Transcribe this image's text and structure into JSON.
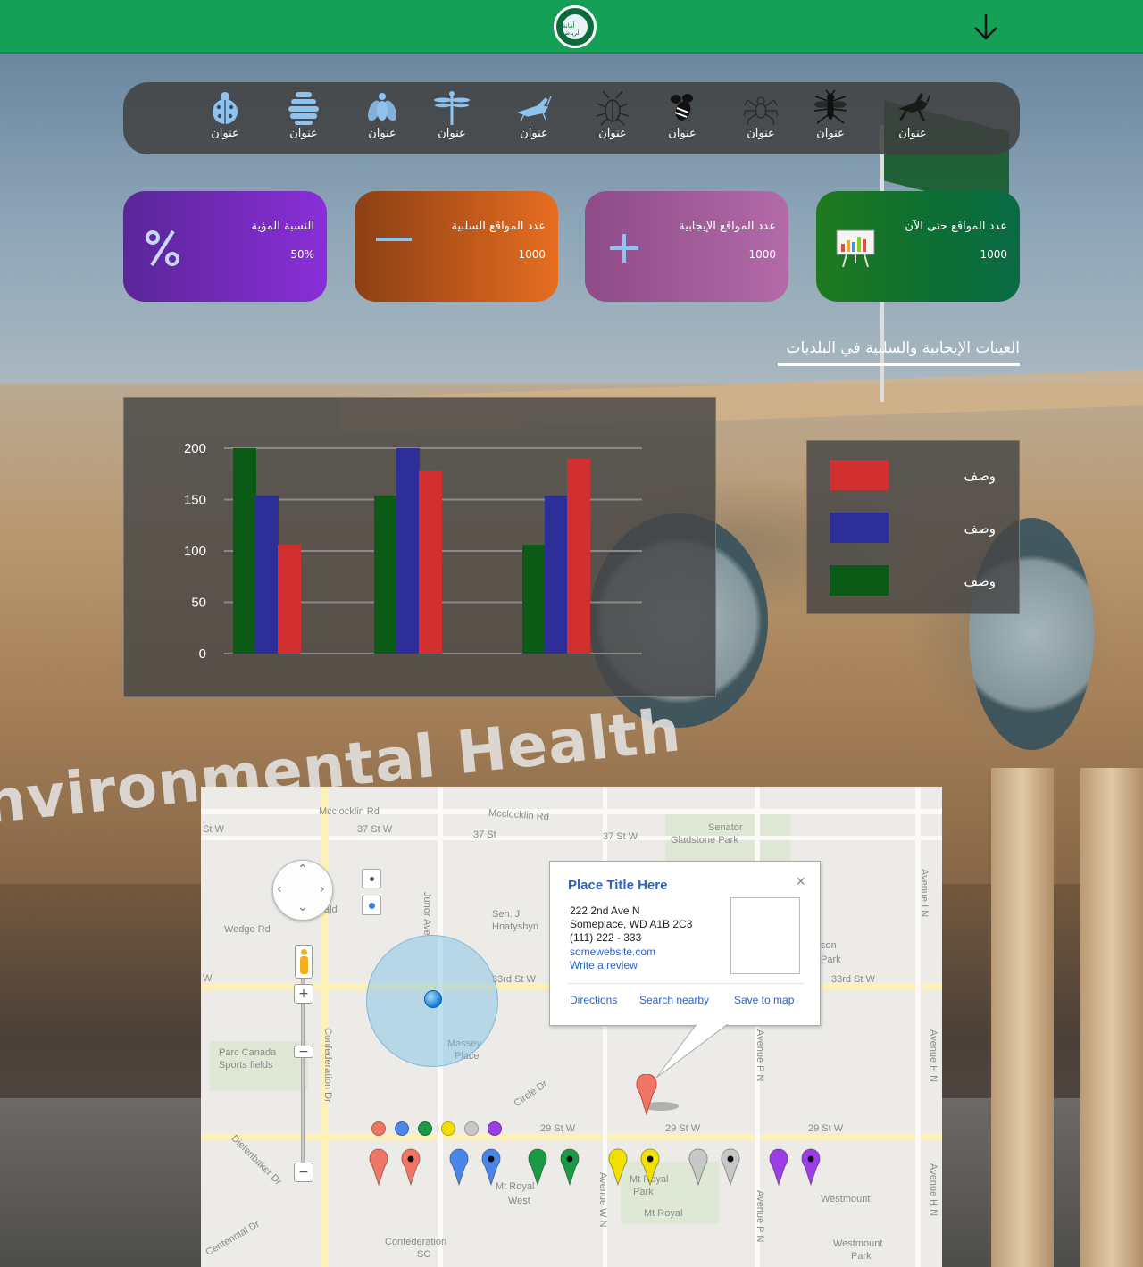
{
  "header": {
    "logo_icon": "riyadh-municipality-logo",
    "logo_text": "أمانة الرياض",
    "menu_icon": "arrow-down-icon"
  },
  "insects": [
    {
      "icon": "grasshopper-icon",
      "label": "عنوان",
      "color": "#1a1a1a"
    },
    {
      "icon": "mosquito-icon",
      "label": "عنوان",
      "color": "#111111"
    },
    {
      "icon": "spider-icon",
      "label": "عنوان",
      "color": "#2a2a2a"
    },
    {
      "icon": "bee-icon",
      "label": "عنوان",
      "color": "#111111"
    },
    {
      "icon": "cockroach-icon",
      "label": "عنوان",
      "color": "#222222"
    },
    {
      "icon": "cricket-icon",
      "label": "عنوان",
      "color": "#8fc3ef"
    },
    {
      "icon": "dragonfly-icon",
      "label": "عنوان",
      "color": "#8fc3ef"
    },
    {
      "icon": "fly-icon",
      "label": "عنوان",
      "color": "#8fc3ef"
    },
    {
      "icon": "beehive-icon",
      "label": "عنوان",
      "color": "#8fc3ef"
    },
    {
      "icon": "ladybug-icon",
      "label": "عنوان",
      "color": "#8fc3ef"
    }
  ],
  "stats": [
    {
      "title": "عدد المواقع حتى الآن",
      "value": "1000",
      "icon": "presentation-chart-icon"
    },
    {
      "title": "عدد المواقع الإيجابية",
      "value": "1000",
      "icon": "plus-icon"
    },
    {
      "title": "عدد المواقع السلبية",
      "value": "1000",
      "icon": "minus-icon"
    },
    {
      "title": "النسبة المؤية",
      "value": "50%",
      "icon": "percent-icon"
    }
  ],
  "section": {
    "title": "العينات الإيجابية والسلبية في البلديات"
  },
  "chart_data": {
    "type": "bar",
    "categories": [
      "",
      "",
      ""
    ],
    "series": [
      {
        "values": [
          200,
          154,
          106
        ],
        "color": "#0b5a16"
      },
      {
        "values": [
          154,
          200,
          154
        ],
        "color": "#2e2e99"
      },
      {
        "values": [
          106,
          178,
          190
        ],
        "color": "#d22f30"
      }
    ],
    "yticks": [
      "200",
      "150",
      "100",
      "50",
      "0"
    ],
    "ylim": [
      0,
      200
    ],
    "grid": true,
    "legend": "right"
  },
  "legend": {
    "items": [
      {
        "label": "وصف",
        "color": "#d22f30"
      },
      {
        "label": "وصف",
        "color": "#2e2e99"
      },
      {
        "label": "وصف",
        "color": "#0b5a16"
      }
    ]
  },
  "map": {
    "labels": {
      "mcclocklin_rd_1": "Mcclocklin Rd",
      "mcclocklin_rd_2": "Mcclocklin Rd",
      "st37_1": "37 St W",
      "st37_2": "37 St",
      "st37_3": "37 St W",
      "senator": "Senator",
      "gladstone": "Gladstone Park",
      "wedge": "Wedge Rd",
      "junor": "Junor Ave",
      "sen_j": "Sen. J.",
      "hnatyshyn": "Hnatyshyn",
      "st33_1": "33rd St W",
      "st33_2": "33rd St W",
      "park_partial": "Park",
      "son_partial": "son",
      "massey": "Massey",
      "place": "Place",
      "parc_canada": "Parc Canada",
      "sports_fields": "Sports fields",
      "confederation_dr": "Confederation Dr",
      "circle_dr": "Circle Dr",
      "st29_1": "29 St W",
      "st29_2": "29 St W",
      "st29_3": "29 St W",
      "diefenbaker": "Diefenbaker Dr",
      "centennial": "Centennial Dr",
      "mt_royal_west": "Mt Royal",
      "west": "West",
      "mt_royal_park": "Mt Royal",
      "park2": "Park",
      "mt_royal": "Mt Royal",
      "westmount": "Westmount",
      "westmount_park": "Westmount",
      "park3": "Park",
      "confederation_sc": "Confederation",
      "sc": "SC",
      "avenue_p": "Avenue P N",
      "avenue_i": "Avenue I N",
      "avenue_h": "Avenue H N",
      "avenue_w": "Avenue W N",
      "st_w_left": "St W",
      "w_left": "W",
      "ald": "ald"
    },
    "infowindow": {
      "title": "Place Title Here",
      "address1": "222 2nd Ave N",
      "address2": "Someplace, WD A1B 2C3",
      "phone": "(111) 222 - 333",
      "website": "somewebsite.com",
      "review": "Write a review",
      "directions": "Directions",
      "search_nearby": "Search nearby",
      "save_to_map": "Save to map",
      "close": "×"
    },
    "marker_colors": [
      "#f07565",
      "#4a86e8",
      "#1a9a44",
      "#f2e100",
      "#c8c8c8",
      "#9b3ee6"
    ]
  }
}
